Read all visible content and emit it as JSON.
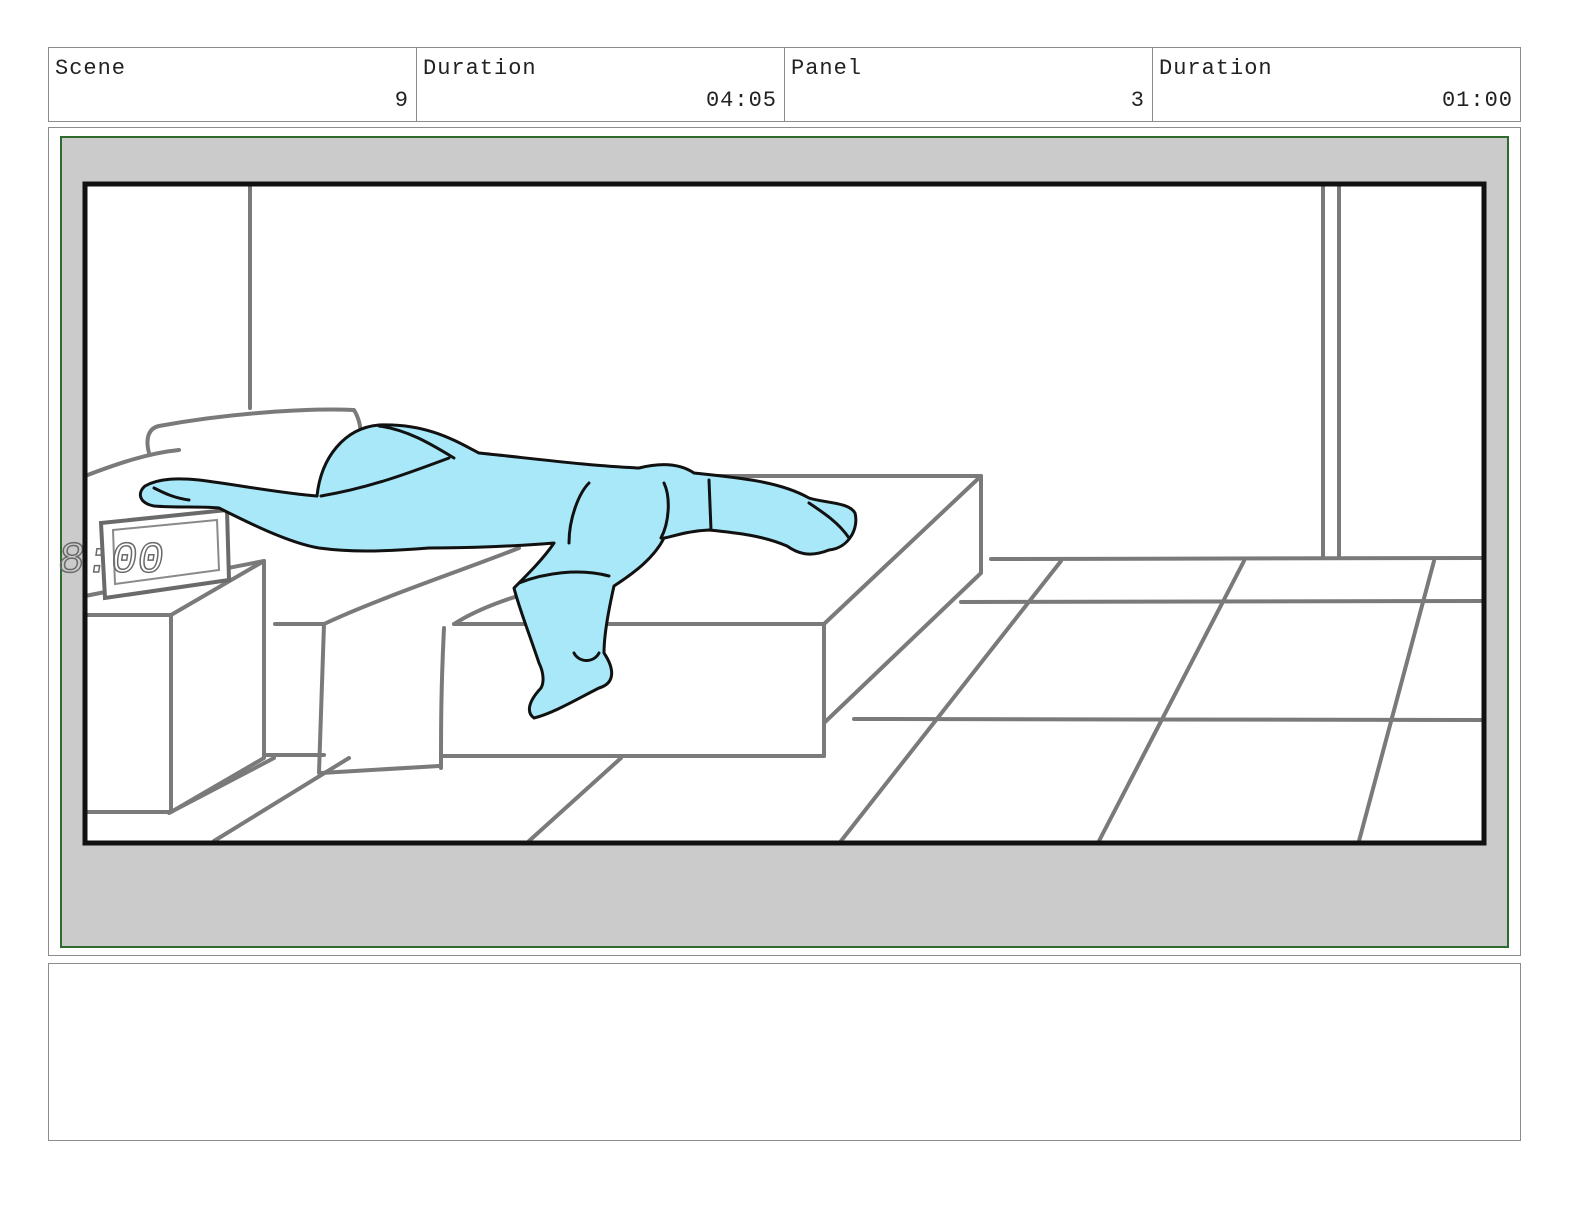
{
  "header": {
    "scene_label": "Scene",
    "scene_value": "9",
    "scene_duration_label": "Duration",
    "scene_duration_value": "04:05",
    "panel_label": "Panel",
    "panel_value": "3",
    "panel_duration_label": "Duration",
    "panel_duration_value": "01:00"
  },
  "panel": {
    "clock_text": "8:00",
    "character_color": "#a8e8f8",
    "safe_area_color": "#2f6b2f",
    "matte_color": "#cbcbcb"
  },
  "notes": {
    "text": ""
  }
}
